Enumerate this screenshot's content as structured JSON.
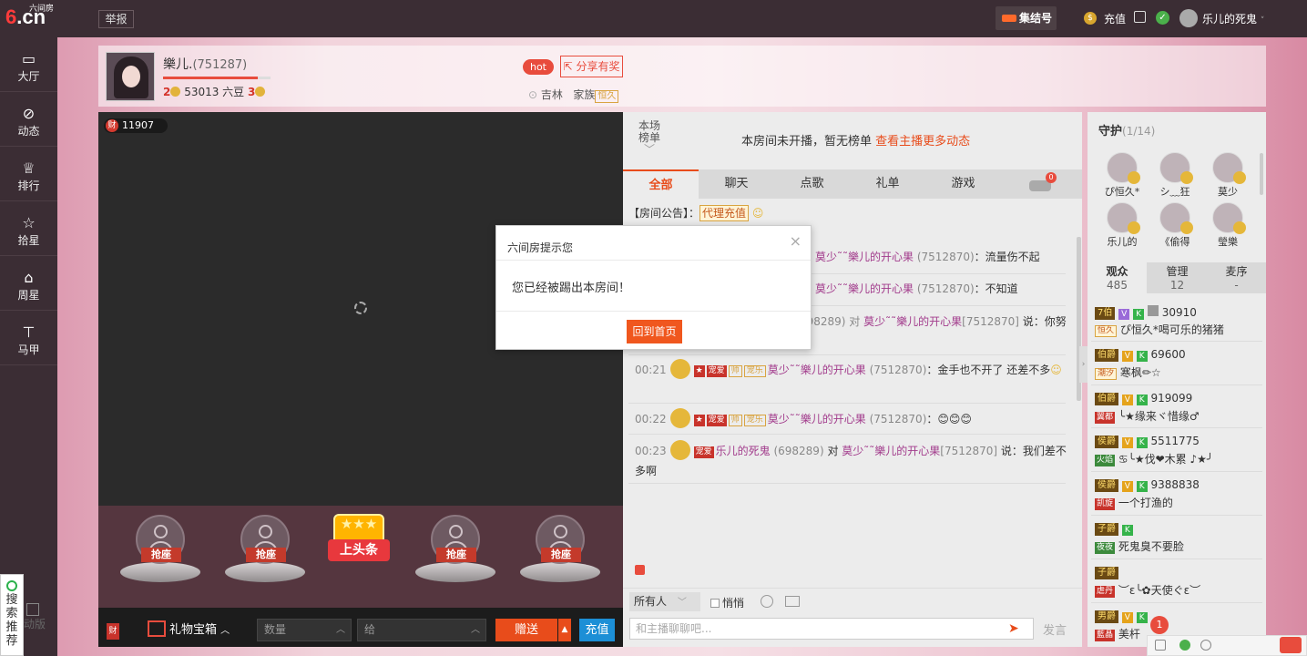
{
  "app": {
    "logo_main": "6.cn",
    "logo_sub": "六间房"
  },
  "topbar": {
    "report_label": "举报",
    "gather_label": "集结号",
    "recharge_label": "充值",
    "coin_glyph": "$",
    "username": "乐儿的死鬼",
    "user_caret": "˅"
  },
  "leftnav": {
    "items": [
      {
        "label": "大厅",
        "icon": "tv-icon"
      },
      {
        "label": "动态",
        "icon": "compass-icon"
      },
      {
        "label": "排行",
        "icon": "crown-icon"
      },
      {
        "label": "拾星",
        "icon": "star-icon"
      },
      {
        "label": "周星",
        "icon": "bag-icon"
      },
      {
        "label": "马甲",
        "icon": "shirt-icon"
      }
    ],
    "search_rec": "搜索推荐",
    "old_version": "动版"
  },
  "anchor": {
    "name": "樂儿.",
    "room_id": "(751287)",
    "level_left": "2",
    "beans": "53013 六豆",
    "level_right": "3",
    "level_progress": 0.88,
    "hot_label": "hot",
    "share_label": "分享有奖",
    "location": "吉林",
    "family_label": "家族",
    "family_tag": "恒久"
  },
  "video": {
    "cai_count": "11907",
    "cai_glyph": "财"
  },
  "seats": {
    "grab_label": "抢座",
    "headline_label": "上头条",
    "headline_stars": "★★★"
  },
  "bottombar": {
    "cai_glyph": "财",
    "giftbox_label": "礼物宝箱",
    "qty_placeholder": "数量",
    "give_to_placeholder": "给",
    "send_label": "赠送",
    "recharge_label": "充值"
  },
  "chat": {
    "rank_label": "本场榜单",
    "rank_text": "本房间未开播，暂无榜单",
    "rank_link": "查看主播更多动态",
    "tabs": [
      "全部",
      "聊天",
      "点歌",
      "礼单",
      "游戏"
    ],
    "car_count": "0",
    "announce_prefix": "【房间公告】：",
    "announce_tag": "代理充值",
    "messages": [
      {
        "time": "",
        "name": "莫少˜˜樂儿的开心果",
        "rid": "(7512870)",
        "text": "：流量伤不起"
      },
      {
        "time": "",
        "name": "莫少˜˜樂儿的开心果",
        "rid": "(7512870)",
        "text": "：不知道"
      },
      {
        "time": "",
        "prefix": "698289) 对",
        "name": "莫少˜˜樂儿的开心果",
        "rid": "[7512870]",
        "text": " 说：你努"
      },
      {
        "time": "00:21",
        "name": "莫少˜˜樂儿的开心果",
        "rid": "(7512870)",
        "text": "：金手也不开了 还差不多"
      },
      {
        "time": "00:22",
        "name": "莫少˜˜樂儿的开心果",
        "rid": "(7512870)",
        "text": "：😊😊😊"
      },
      {
        "time": "00:23",
        "sender": "乐儿的死鬼",
        "sender_rid": "(698289)",
        "to": " 对 ",
        "name": "莫少˜˜樂儿的开心果",
        "rid": "[7512870]",
        "text": " 说：我们差不多啊"
      }
    ],
    "badge_pet": "宠乐",
    "badge_love": "宠爱",
    "badge_handsome": "帅",
    "to_all": "所有人",
    "quiet_label": "悄悄",
    "input_placeholder": "和主播聊聊吧...",
    "send_label": "发言"
  },
  "guard": {
    "title": "守护",
    "count": "(1/14)",
    "members": [
      "ぴ恒久*",
      "シ﹏狂",
      "莫少",
      "乐儿的",
      "《偷得",
      "瑩樂"
    ]
  },
  "audience_tabs": [
    {
      "label": "观众",
      "num": "485"
    },
    {
      "label": "管理",
      "num": "12"
    },
    {
      "label": "麦序",
      "num": "-"
    }
  ],
  "audience": [
    {
      "lv": "7伯",
      "id": "30910",
      "fam": "恒久",
      "name": "ぴ恒久*喝可乐的猪猪"
    },
    {
      "lv": "伯爵",
      "id": "69600",
      "fam": "潮汐",
      "name": "寒枫✏☆"
    },
    {
      "lv": "伯爵",
      "id": "919099",
      "fam": "翼都",
      "name": "╰★缘来ヾ惜缘♂"
    },
    {
      "lv": "侯爵",
      "id": "5511775",
      "fam": "火焰",
      "name": "♋╰★伐❤木累 ♪★╯"
    },
    {
      "lv": "侯爵",
      "id": "9388838",
      "fam": "凯旋",
      "name": "一个打渔的"
    },
    {
      "lv": "子爵",
      "id": "",
      "fam": "夜夜",
      "name": "死鬼臭不要脸"
    },
    {
      "lv": "子爵",
      "id": "",
      "fam": "虐丹",
      "name": "︶ε╰✿天使ぐε︶"
    },
    {
      "lv": "男爵",
      "id": "",
      "fam": "藍晶",
      "name": "美杆"
    }
  ],
  "modal": {
    "title": "六间房提示您",
    "close": "×",
    "message": "您已经被踢出本房间！",
    "button": "回到首页"
  },
  "corner": {
    "notify_count": "1"
  }
}
